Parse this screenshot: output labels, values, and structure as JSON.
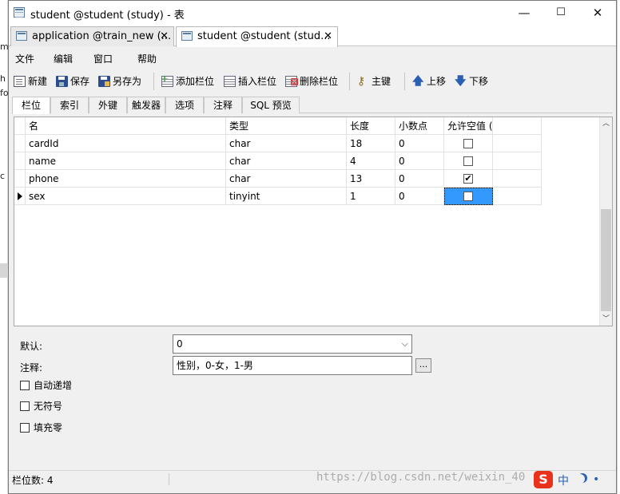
{
  "window": {
    "title": "student @student (study) - 表",
    "controls": {
      "minimize": "—",
      "maximize": "☐",
      "close": "✕"
    }
  },
  "doc_tabs": [
    {
      "label": "application @train_new (...",
      "close": "✕"
    },
    {
      "label": "student @student (stud...",
      "close": "✕"
    }
  ],
  "menu": [
    "文件",
    "编辑",
    "窗口",
    "帮助"
  ],
  "toolbar": {
    "new": "新建",
    "save": "保存",
    "save_as": "另存为",
    "add_column": "添加栏位",
    "insert_column": "插入栏位",
    "delete_column": "删除栏位",
    "primary_key": "主键",
    "move_up": "上移",
    "move_down": "下移"
  },
  "sub_tabs": [
    "栏位",
    "索引",
    "外键",
    "触发器",
    "选项",
    "注释",
    "SQL 预览"
  ],
  "grid": {
    "headers": [
      "名",
      "类型",
      "长度",
      "小数点",
      "允许空值 ("
    ],
    "rows": [
      {
        "name": "cardId",
        "type": "char",
        "length": "18",
        "decimals": "0",
        "nullable": false
      },
      {
        "name": "name",
        "type": "char",
        "length": "4",
        "decimals": "0",
        "nullable": false
      },
      {
        "name": "phone",
        "type": "char",
        "length": "13",
        "decimals": "0",
        "nullable": true
      },
      {
        "name": "sex",
        "type": "tinyint",
        "length": "1",
        "decimals": "0",
        "nullable": false,
        "selected": true
      }
    ]
  },
  "properties": {
    "default_label": "默认:",
    "default_value": "0",
    "comment_label": "注释:",
    "comment_value": "性别，0-女，1-男",
    "ellipsis": "...",
    "auto_increment": "自动递增",
    "unsigned": "无符号",
    "zerofill": "填充零"
  },
  "status": {
    "column_count": "栏位数: 4"
  },
  "watermark": "https://blog.csdn.net/weixin_40",
  "ime": {
    "logo": "S",
    "mode": "中",
    "dot": "•"
  },
  "left_edge_fragments": [
    "m",
    "h",
    "fo",
    "c"
  ],
  "colors": {
    "selection": "#3399ff",
    "ime_logo": "#e8321b"
  }
}
